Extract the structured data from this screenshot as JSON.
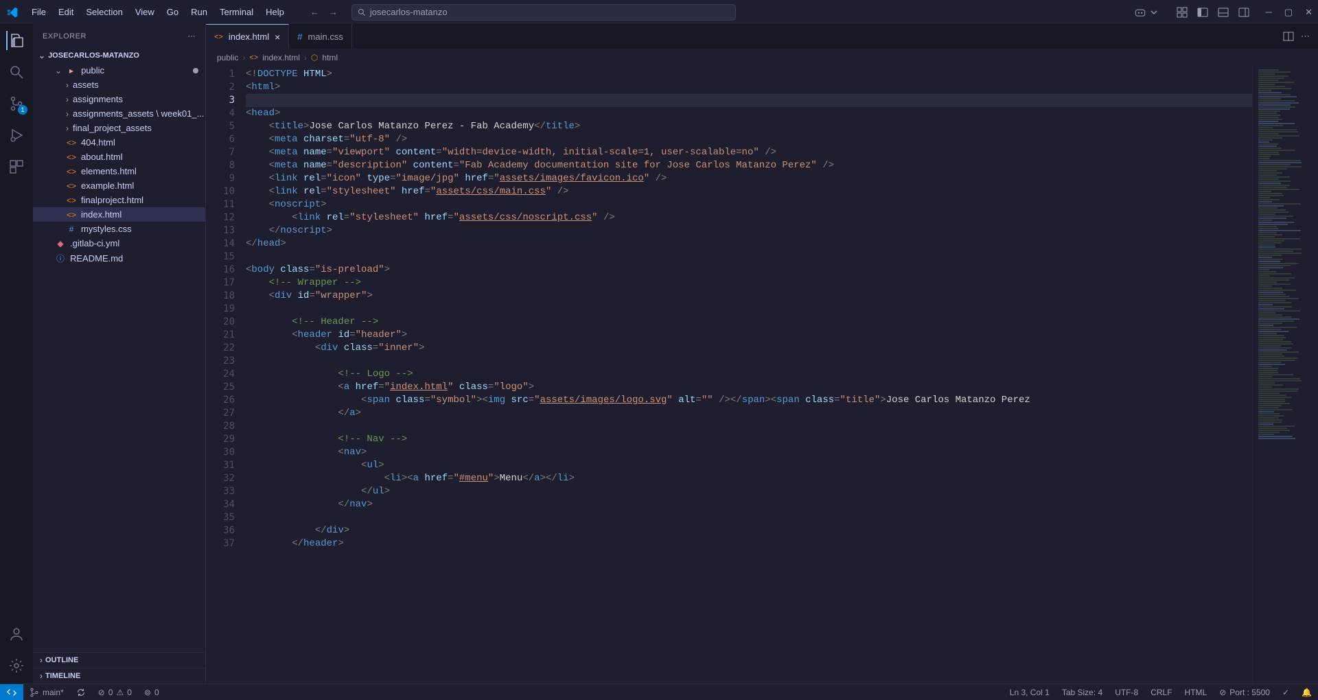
{
  "menu": {
    "file": "File",
    "edit": "Edit",
    "selection": "Selection",
    "view": "View",
    "go": "Go",
    "run": "Run",
    "terminal": "Terminal",
    "help": "Help"
  },
  "search": {
    "placeholder": "josecarlos-matanzo"
  },
  "sidebar": {
    "title": "EXPLORER",
    "folder": "JOSECARLOS-MATANZO",
    "tree": [
      {
        "label": "public",
        "type": "folder"
      },
      {
        "label": "assets",
        "type": "folder"
      },
      {
        "label": "assignments",
        "type": "folder"
      },
      {
        "label": "assignments_assets \\ week01_...",
        "type": "folder",
        "modified": true
      },
      {
        "label": "final_project_assets",
        "type": "folder"
      },
      {
        "label": "404.html",
        "type": "html"
      },
      {
        "label": "about.html",
        "type": "html"
      },
      {
        "label": "elements.html",
        "type": "html"
      },
      {
        "label": "example.html",
        "type": "html"
      },
      {
        "label": "finalproject.html",
        "type": "html"
      },
      {
        "label": "index.html",
        "type": "html",
        "selected": true
      },
      {
        "label": "mystyles.css",
        "type": "css"
      },
      {
        "label": ".gitlab-ci.yml",
        "type": "yml"
      },
      {
        "label": "README.md",
        "type": "md"
      }
    ],
    "outline": "OUTLINE",
    "timeline": "TIMELINE"
  },
  "tabs": [
    {
      "label": "index.html",
      "icon": "html",
      "active": true,
      "close": true
    },
    {
      "label": "main.css",
      "icon": "css",
      "active": false,
      "close": false
    }
  ],
  "breadcrumb": {
    "p1": "public",
    "p2": "index.html",
    "p3": "html"
  },
  "scm_badge": "1",
  "code": {
    "lines": [
      1,
      2,
      3,
      4,
      5,
      6,
      7,
      8,
      9,
      10,
      11,
      12,
      13,
      14,
      15,
      16,
      17,
      18,
      19,
      20,
      21,
      22,
      23,
      24,
      25,
      26,
      27,
      28,
      29,
      30,
      31,
      32,
      33,
      34,
      35,
      36,
      37
    ]
  },
  "status": {
    "branch": "main*",
    "errors": "0",
    "warnings": "0",
    "port_info": "0",
    "ln": "Ln 3, Col 1",
    "tab": "Tab Size: 4",
    "enc": "UTF-8",
    "eol": "CRLF",
    "lang": "HTML",
    "port": "Port : 5500"
  }
}
